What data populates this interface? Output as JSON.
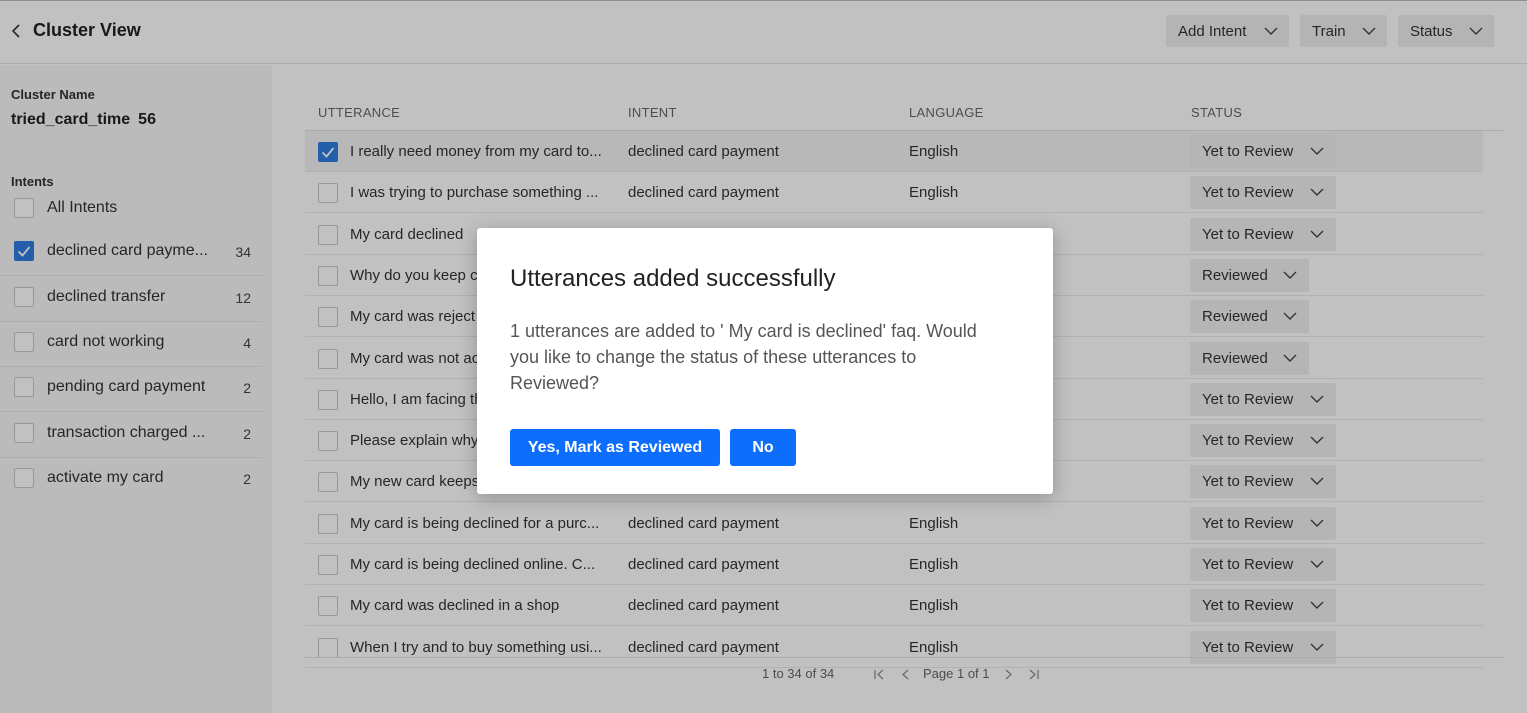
{
  "header": {
    "title": "Cluster View",
    "buttons": [
      "Add Intent",
      "Train",
      "Status"
    ]
  },
  "sidebar": {
    "cluster_name_label": "Cluster Name",
    "cluster_name": "tried_card_time",
    "cluster_count": "56",
    "intents_label": "Intents",
    "intents": [
      {
        "label": "All Intents",
        "count": "",
        "checked": false
      },
      {
        "label": "declined card payme...",
        "count": "34",
        "checked": true
      },
      {
        "label": "declined transfer",
        "count": "12",
        "checked": false
      },
      {
        "label": "card not working",
        "count": "4",
        "checked": false
      },
      {
        "label": "pending card payment",
        "count": "2",
        "checked": false
      },
      {
        "label": "transaction charged ...",
        "count": "2",
        "checked": false
      },
      {
        "label": "activate my card",
        "count": "2",
        "checked": false
      }
    ]
  },
  "table": {
    "headers": [
      "UTTERANCE",
      "INTENT",
      "LANGUAGE",
      "STATUS"
    ],
    "rows": [
      {
        "utterance": "I really need money from my card to...",
        "intent": "declined card payment",
        "language": "English",
        "status": "Yet to Review",
        "checked": true
      },
      {
        "utterance": "I was trying to purchase something ...",
        "intent": "declined card payment",
        "language": "English",
        "status": "Yet to Review",
        "checked": false
      },
      {
        "utterance": "My card declined",
        "intent": "",
        "language": "",
        "status": "Yet to Review",
        "checked": false
      },
      {
        "utterance": "Why do you keep c",
        "intent": "",
        "language": "",
        "status": "Reviewed",
        "checked": false
      },
      {
        "utterance": "My card was reject",
        "intent": "",
        "language": "",
        "status": "Reviewed",
        "checked": false
      },
      {
        "utterance": "My card was not ac",
        "intent": "",
        "language": "",
        "status": "Reviewed",
        "checked": false
      },
      {
        "utterance": "Hello, I am facing th",
        "intent": "",
        "language": "",
        "status": "Yet to Review",
        "checked": false
      },
      {
        "utterance": "Please explain why",
        "intent": "",
        "language": "",
        "status": "Yet to Review",
        "checked": false
      },
      {
        "utterance": "My new card keeps",
        "intent": "",
        "language": "",
        "status": "Yet to Review",
        "checked": false
      },
      {
        "utterance": "My card is being declined for a purc...",
        "intent": "declined card payment",
        "language": "English",
        "status": "Yet to Review",
        "checked": false
      },
      {
        "utterance": "My card is being declined online. C...",
        "intent": "declined card payment",
        "language": "English",
        "status": "Yet to Review",
        "checked": false
      },
      {
        "utterance": "My card was declined in a shop",
        "intent": "declined card payment",
        "language": "English",
        "status": "Yet to Review",
        "checked": false
      },
      {
        "utterance": "When I try and to buy something usi...",
        "intent": "declined card payment",
        "language": "English",
        "status": "Yet to Review",
        "checked": false
      }
    ]
  },
  "pagination": {
    "range": "1 to 34 of 34",
    "page": "Page 1 of 1"
  },
  "modal": {
    "title": "Utterances added successfully",
    "body": "1 utterances are added to ' My card is declined' faq. Would you like to change the status of these utterances to Reviewed?",
    "yes_label": "Yes, Mark as Reviewed",
    "no_label": "No"
  },
  "colors": {
    "primary": "#0d6efd",
    "checkbox": "#2f7de1",
    "overlay": "rgba(0,0,0,0.245)"
  }
}
